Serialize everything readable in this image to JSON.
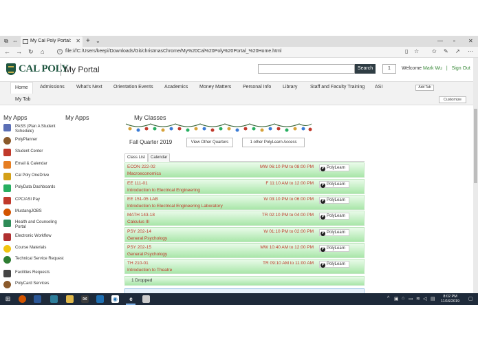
{
  "browser": {
    "tab_title": "My Cal Poly Portal: H",
    "address": "file:///C:/Users/keepi/Downloads/Git/christmasChrome/My%20Cal%20Poly%20Portal_%20Home.html"
  },
  "header": {
    "logo_text": "CAL POLY",
    "portal_title": "My Portal",
    "search_button": "Search",
    "count": "1",
    "welcome_label": "Welcome",
    "user_name": "Mark Wu",
    "separator": "|",
    "sign_out": "Sign Out"
  },
  "nav": {
    "items": [
      "Home",
      "Admissions",
      "What's Next",
      "Orientation Events",
      "Academics",
      "Money Matters",
      "Personal Info",
      "Library",
      "Staff and Faculty Training",
      "ASI"
    ],
    "add_tab": "Add Tab",
    "my_tab": "My Tab",
    "customize": "Customize"
  },
  "left": {
    "title": "My Apps",
    "apps": [
      "PASS (Plan A Student Schedule)",
      "PolyPlanner",
      "Student Center",
      "Email & Calendar",
      "Cal Poly OneDrive",
      "PolyData Dashboards",
      "CPC/ASI Pay",
      "MustangJOBS",
      "Health and Counseling Portal",
      "Electronic Workflow",
      "Course Materials",
      "Technical Service Request",
      "Facilities Requests",
      "PolyCard Services"
    ]
  },
  "middle": {
    "title": "My Apps"
  },
  "classes": {
    "title": "My Classes",
    "quarter": "Fall Quarter 2019",
    "view_other": "View Other Quarters",
    "polylearn_access": "1 other PolyLearn Access",
    "tabs": [
      "Class List",
      "Calendar"
    ],
    "polylearn_label": "PolyLearn",
    "polylearn_icon": "P",
    "list": [
      {
        "code": "ECON 222-02",
        "title": "Macroeconomics",
        "time": "MW 06:10 PM to 08:00 PM"
      },
      {
        "code": "EE 111-01",
        "title": "Introduction to Electrical Engineering",
        "time": "F 11:10 AM to 12:00 PM"
      },
      {
        "code": "EE 151-05 LAB",
        "title": "Introduction to Electrical Engineering Laboratory",
        "time": "W 03:10 PM to 06:00 PM"
      },
      {
        "code": "MATH 143-18",
        "title": "Calculus III",
        "time": "TR 02:10 PM to 04:00 PM"
      },
      {
        "code": "PSY 202-14",
        "title": "General Psychology",
        "time": "W 01:10 PM to 02:00 PM"
      },
      {
        "code": "PSY 202-15",
        "title": "General Psychology",
        "time": "MW 10:40 AM to 12:00 PM"
      },
      {
        "code": "TH 210-01",
        "title": "Introduction to Theatre",
        "time": "TR 09:10 AM to 11:00 AM"
      }
    ],
    "dropped": "1 Dropped"
  },
  "taskbar": {
    "time": "8:02 PM",
    "date": "11/16/2019"
  },
  "colors": {
    "brand_green": "#1f5640",
    "brand_gold": "#c9b04a",
    "class_text": "#c0392b",
    "row_green": "#a9e6a9"
  }
}
